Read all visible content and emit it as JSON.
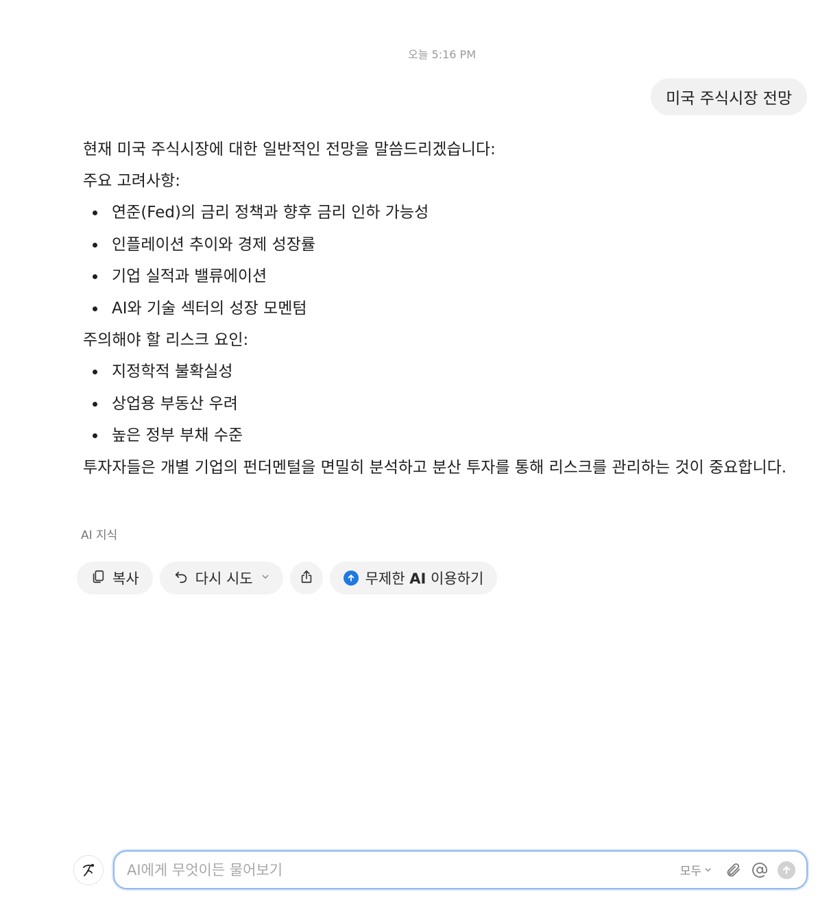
{
  "timestamp": "오늘 5:16 PM",
  "user_message": "미국 주식시장 전망",
  "answer": {
    "intro": "현재 미국 주식시장에 대한 일반적인 전망을 말씀드리겠습니다:",
    "considerations_heading": "주요 고려사항:",
    "considerations": [
      "연준(Fed)의 금리 정책과 향후 금리 인하 가능성",
      "인플레이션 추이와 경제 성장률",
      "기업 실적과 밸류에이션",
      "AI와 기술 섹터의 성장 모멘텀"
    ],
    "risks_heading": "주의해야 할 리스크 요인:",
    "risks": [
      "지정학적 불확실성",
      "상업용 부동산 우려",
      "높은 정부 부채 수준"
    ],
    "closing": "투자자들은 개별 기업의 펀더멘털을 면밀히 분석하고 분산 투자를 통해 리스크를 관리하는 것이 중요합니다."
  },
  "source_label": "AI 지식",
  "actions": {
    "copy_label": "복사",
    "retry_label": "다시 시도",
    "unlimited_prefix": "무제한 ",
    "unlimited_ai": "AI",
    "unlimited_suffix": " 이용하기"
  },
  "composer": {
    "placeholder": "AI에게 무엇이든 물어보기",
    "mode_label": "모두"
  },
  "colors": {
    "accent": "#1f7ae0",
    "composer_border": "#8fb8ea",
    "chip_bg": "#f3f3f4",
    "bubble_bg": "#f1f1f2"
  },
  "icons": {
    "copy": "copy-icon",
    "retry": "undo-icon",
    "share": "share-icon",
    "unlimited": "arrow-up-circle-icon",
    "attach": "paperclip-icon",
    "mention": "at-icon",
    "send": "send-icon",
    "avatar": "ai-logo-icon"
  }
}
